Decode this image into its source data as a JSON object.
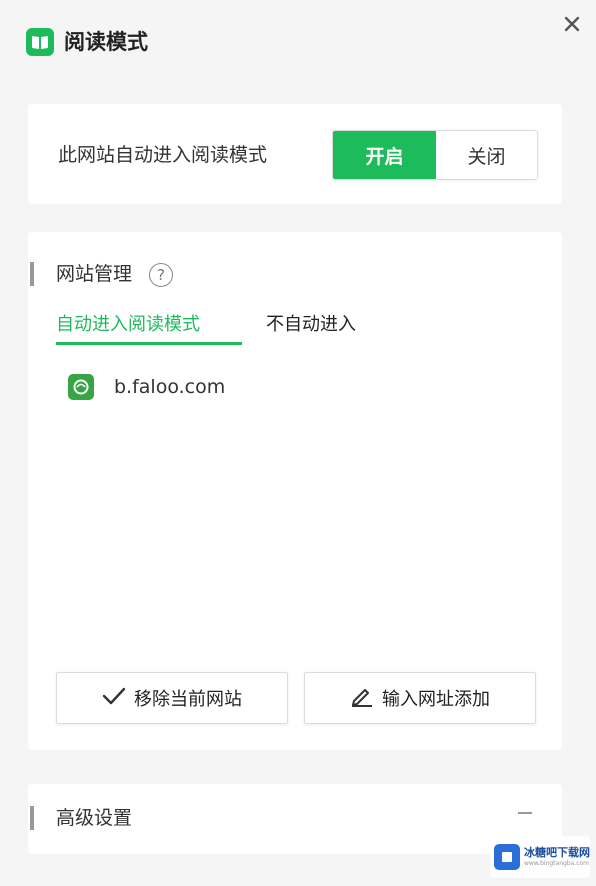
{
  "header": {
    "title": "阅读模式",
    "close_icon": "close-icon",
    "app_icon": "book-icon"
  },
  "auto_reading": {
    "label": "此网站自动进入阅读模式",
    "on_label": "开启",
    "off_label": "关闭",
    "selected": "开启"
  },
  "site_management": {
    "title": "网站管理",
    "help_symbol": "?",
    "tabs": [
      {
        "label": "自动进入阅读模式",
        "active": true
      },
      {
        "label": "不自动进入",
        "active": false
      }
    ],
    "sites": [
      {
        "domain": "b.faloo.com",
        "icon": "faloo-favicon"
      }
    ],
    "remove_button": "移除当前网站",
    "add_button": "输入网址添加"
  },
  "advanced": {
    "title": "高级设置",
    "collapse_icon": "minus-icon"
  },
  "watermark": {
    "main": "冰糖吧下载网",
    "sub": "www.bingtangba.com"
  },
  "colors": {
    "accent": "#1dbb5b",
    "background": "#f5f5f5",
    "card": "#ffffff"
  }
}
